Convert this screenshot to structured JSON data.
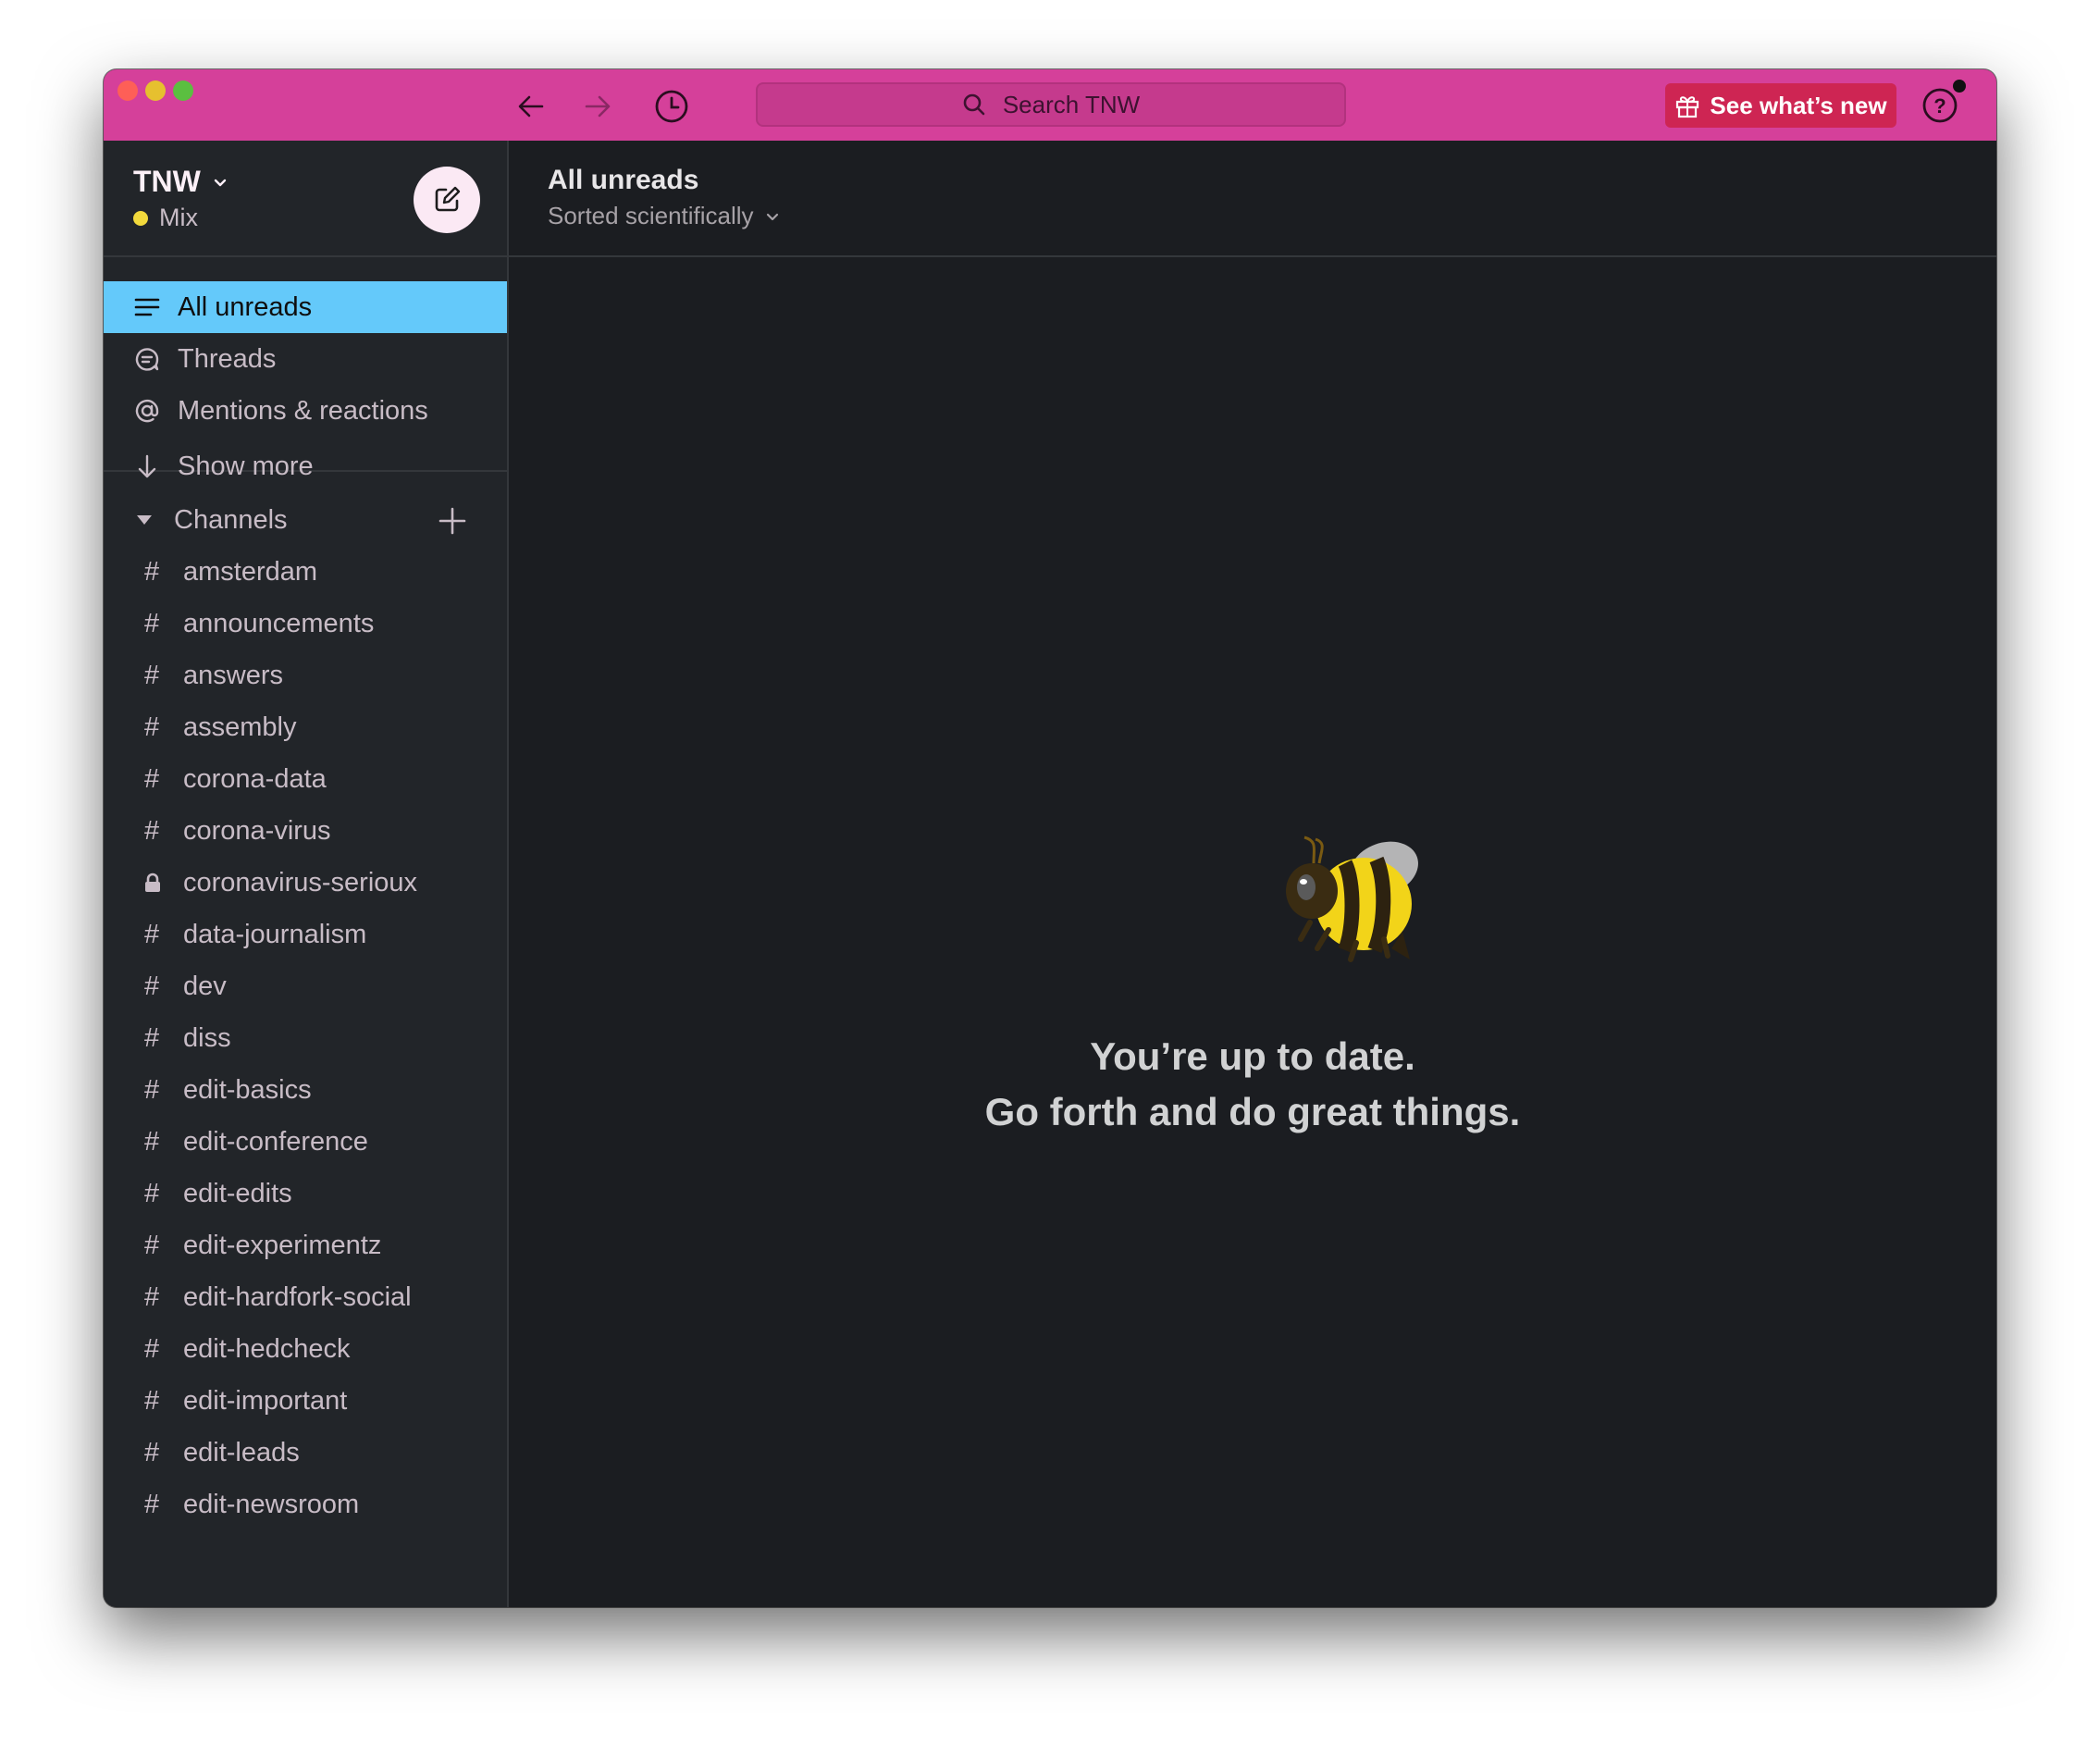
{
  "titlebar": {
    "search_placeholder": "Search TNW",
    "whats_new_label": "See what’s new",
    "icons": [
      "back-arrow-icon",
      "forward-arrow-icon",
      "history-clock-icon",
      "search-icon",
      "gift-icon",
      "help-icon"
    ],
    "accent_color": "#D5409A",
    "whats_new_color": "#CE2553"
  },
  "workspace": {
    "name": "TNW",
    "status": "Mix",
    "status_color": "#F2D93C"
  },
  "sidebar": {
    "nav_items": [
      {
        "label": "All unreads",
        "icon": "list-lines-icon",
        "active": true
      },
      {
        "label": "Threads",
        "icon": "thread-bubble-icon",
        "active": false
      },
      {
        "label": "Mentions & reactions",
        "icon": "at-sign-icon",
        "active": false
      },
      {
        "label": "Show more",
        "icon": "arrow-down-icon",
        "active": false
      }
    ],
    "active_color": "#64C9FA",
    "channels_header": "Channels",
    "channels": [
      {
        "name": "amsterdam",
        "private": false
      },
      {
        "name": "announcements",
        "private": false
      },
      {
        "name": "answers",
        "private": false
      },
      {
        "name": "assembly",
        "private": false
      },
      {
        "name": "corona-data",
        "private": false
      },
      {
        "name": "corona-virus",
        "private": false
      },
      {
        "name": "coronavirus-serioux",
        "private": true
      },
      {
        "name": "data-journalism",
        "private": false
      },
      {
        "name": "dev",
        "private": false
      },
      {
        "name": "diss",
        "private": false
      },
      {
        "name": "edit-basics",
        "private": false
      },
      {
        "name": "edit-conference",
        "private": false
      },
      {
        "name": "edit-edits",
        "private": false
      },
      {
        "name": "edit-experimentz",
        "private": false
      },
      {
        "name": "edit-hardfork-social",
        "private": false
      },
      {
        "name": "edit-hedcheck",
        "private": false
      },
      {
        "name": "edit-important",
        "private": false
      },
      {
        "name": "edit-leads",
        "private": false
      },
      {
        "name": "edit-newsroom",
        "private": false
      }
    ]
  },
  "main": {
    "title": "All unreads",
    "sort_label": "Sorted scientifically",
    "empty_line1": "You’re up to date.",
    "empty_line2": "Go forth and do great things.",
    "illustration": "bee-emoji"
  }
}
